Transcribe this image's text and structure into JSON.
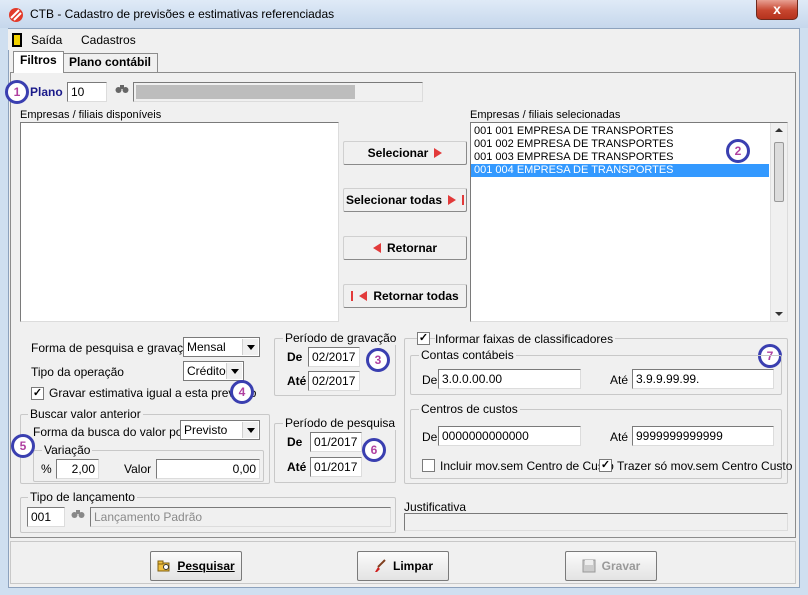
{
  "window": {
    "title": "CTB - Cadastro de previsões e estimativas referenciadas",
    "close_label": "x"
  },
  "menu": {
    "items": [
      "Saída",
      "Cadastros"
    ]
  },
  "tabs": [
    "Filtros",
    "Plano contábil"
  ],
  "plano": {
    "label": "Plano",
    "value": "10",
    "description": ""
  },
  "available": {
    "label": "Empresas / filiais disponíveis",
    "items": []
  },
  "selected": {
    "label": "Empresas / filiais selecionadas",
    "items": [
      "001 001 EMPRESA DE TRANSPORTES",
      "001 002 EMPRESA DE TRANSPORTES",
      "001 003 EMPRESA DE TRANSPORTES",
      "001 004 EMPRESA DE TRANSPORTES"
    ],
    "selected_index": 3
  },
  "transfer_buttons": {
    "selecionar": "Selecionar",
    "selecionar_todas": "Selecionar todas",
    "retornar": "Retornar",
    "retornar_todas": "Retornar todas"
  },
  "forma_pesquisa": {
    "label": "Forma de pesquisa e gravação",
    "value": "Mensal"
  },
  "tipo_operacao": {
    "label": "Tipo da operação",
    "value": "Crédito"
  },
  "gravar_estimativa": {
    "label": "Gravar estimativa igual a esta previsão",
    "checked": true
  },
  "periodo_gravacao": {
    "title": "Período de gravação",
    "de_label": "De",
    "de": "02/2017",
    "ate_label": "Até",
    "ate": "02/2017"
  },
  "buscar_valor": {
    "title": "Buscar valor anterior",
    "forma_label": "Forma da busca do valor por",
    "forma_value": "Previsto",
    "variacao_title": "Variação",
    "pct_label": "%",
    "pct_value": "2,00",
    "valor_label": "Valor",
    "valor_value": "0,00"
  },
  "periodo_pesquisa": {
    "title": "Período de pesquisa",
    "de_label": "De",
    "de": "01/2017",
    "ate_label": "Até",
    "ate": "01/2017"
  },
  "faixas": {
    "label": "Informar faixas de classificadores",
    "checked": true,
    "contas": {
      "title": "Contas contábeis",
      "de_label": "De",
      "de": "3.0.0.00.00",
      "ate_label": "Até",
      "ate": "3.9.9.99.99."
    },
    "centros": {
      "title": "Centros de custos",
      "de_label": "De",
      "de": "0000000000000",
      "ate_label": "Até",
      "ate": "9999999999999"
    },
    "incluir_sem_cc": {
      "label": "Incluir mov.sem Centro de Custo",
      "checked": false
    },
    "trazer_sem_cc": {
      "label": "Trazer só mov.sem Centro Custo",
      "checked": true
    }
  },
  "tipo_lancamento": {
    "title": "Tipo de lançamento",
    "code": "001",
    "description": "Lançamento Padrão"
  },
  "justificativa": {
    "label": "Justificativa",
    "value": ""
  },
  "footer": {
    "pesquisar": "Pesquisar",
    "limpar": "Limpar",
    "gravar": "Gravar"
  },
  "badges": [
    "1",
    "2",
    "3",
    "4",
    "5",
    "6",
    "7"
  ],
  "colors": {
    "selection": "#3399ff",
    "badge_border": "#3a3fb0",
    "badge_text": "#b040a0",
    "arrow_red": "#e23a3a"
  },
  "icons": {
    "app": "app-logo-icon",
    "exit": "exit-door-icon",
    "search": "binoculars-icon",
    "pesquisar": "folder-search-icon",
    "limpar": "brush-icon",
    "gravar": "save-icon"
  }
}
